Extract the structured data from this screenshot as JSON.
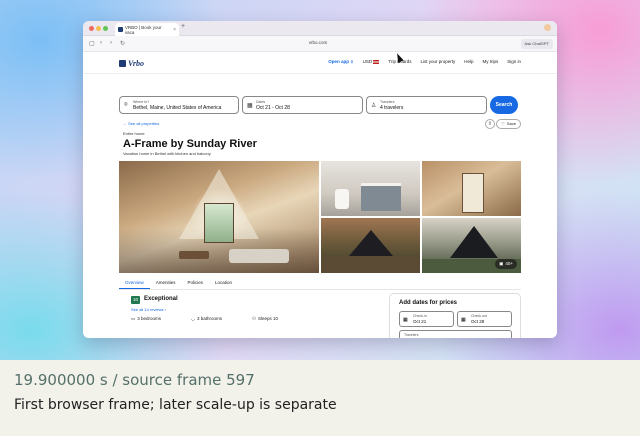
{
  "browser": {
    "tab_title": "VRBO | Book your vaca",
    "tab_close": "×",
    "new_tab": "+",
    "url": "vrbo.com",
    "ask_button": "Ask ChatGPT",
    "nav_back": "‹",
    "nav_forward": "›",
    "nav_reload": "↻",
    "sidebar_toggle": "▢"
  },
  "site_nav": {
    "logo": "Vrbo",
    "open_app": "Open app",
    "currency": "USD",
    "trip_boards": "Trip Boards",
    "list_property": "List your property",
    "help": "Help",
    "my_trips": "My trips",
    "sign_in": "Sign in"
  },
  "search": {
    "where_label": "Where to?",
    "where_value": "Bethel, Maine, United States of America",
    "dates_label": "Dates",
    "dates_value": "Oct 21 - Oct 28",
    "travelers_label": "Travelers",
    "travelers_value": "4 travelers",
    "button": "Search"
  },
  "listing": {
    "back_link": "See all properties",
    "save": "Save",
    "kind": "Entire home",
    "title": "A-Frame by Sunday River",
    "subtitle": "Vacation home in Bethel with kitchen and balcony",
    "photo_count": "40+",
    "tabs": [
      "Overview",
      "Amenities",
      "Policies",
      "Location"
    ],
    "score": "10",
    "rating_text": "Exceptional",
    "reviews_link": "See all 14 reviews",
    "bedrooms": "3 bedrooms",
    "bathrooms": "3 bathrooms",
    "sleeps": "Sleeps 10"
  },
  "booking": {
    "title": "Add dates for prices",
    "checkin_label": "Check-in",
    "checkin_value": "Oct 21",
    "checkout_label": "Check-out",
    "checkout_value": "Oct 28",
    "travelers_label": "Travelers"
  },
  "caption": {
    "time": "19.900000 s / source frame 597",
    "note": "First browser frame; later scale-up is separate"
  },
  "colors": {
    "accent": "#1668e3",
    "brand": "#1f3b73",
    "rating_green": "#227950"
  }
}
